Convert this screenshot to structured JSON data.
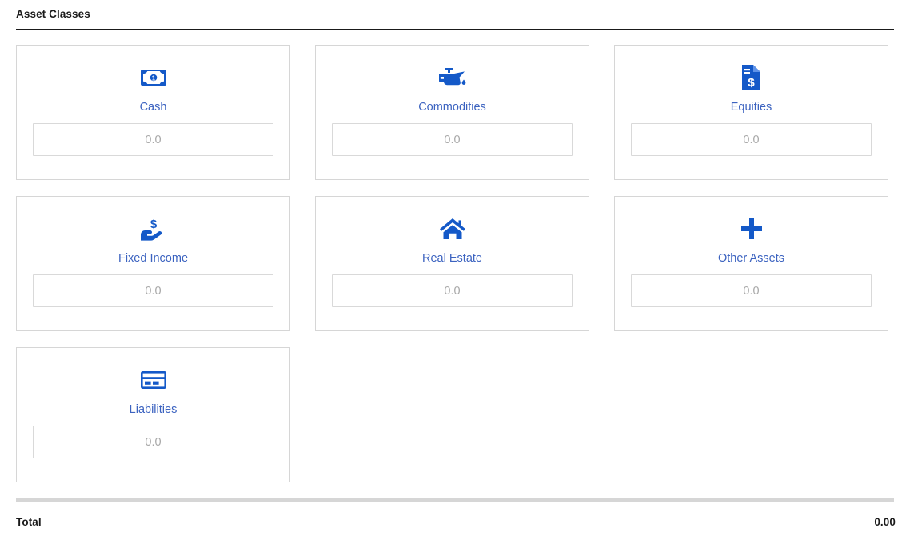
{
  "section": {
    "title": "Asset Classes"
  },
  "cards": [
    {
      "icon": "banknote-icon",
      "label": "Cash",
      "value": "",
      "placeholder": "0.0"
    },
    {
      "icon": "oil-can-icon",
      "label": "Commodities",
      "value": "",
      "placeholder": "0.0"
    },
    {
      "icon": "document-dollar-icon",
      "label": "Equities",
      "value": "",
      "placeholder": "0.0"
    },
    {
      "icon": "hand-holding-dollar-icon",
      "label": "Fixed Income",
      "value": "",
      "placeholder": "0.0"
    },
    {
      "icon": "house-icon",
      "label": "Real Estate",
      "value": "",
      "placeholder": "0.0"
    },
    {
      "icon": "plus-icon",
      "label": "Other Assets",
      "value": "",
      "placeholder": "0.0"
    },
    {
      "icon": "credit-card-icon",
      "label": "Liabilities",
      "value": "",
      "placeholder": "0.0"
    }
  ],
  "footer": {
    "total_label": "Total",
    "total_value": "0.00"
  },
  "colors": {
    "accent_icon": "#1459c8",
    "label_blue": "#3c63c0",
    "card_border": "#d6d6d6",
    "input_border": "#d9d9d9",
    "placeholder": "#a8a8a8",
    "title_rule": "#1a1a1a",
    "footer_rule": "#d6d6d6"
  }
}
